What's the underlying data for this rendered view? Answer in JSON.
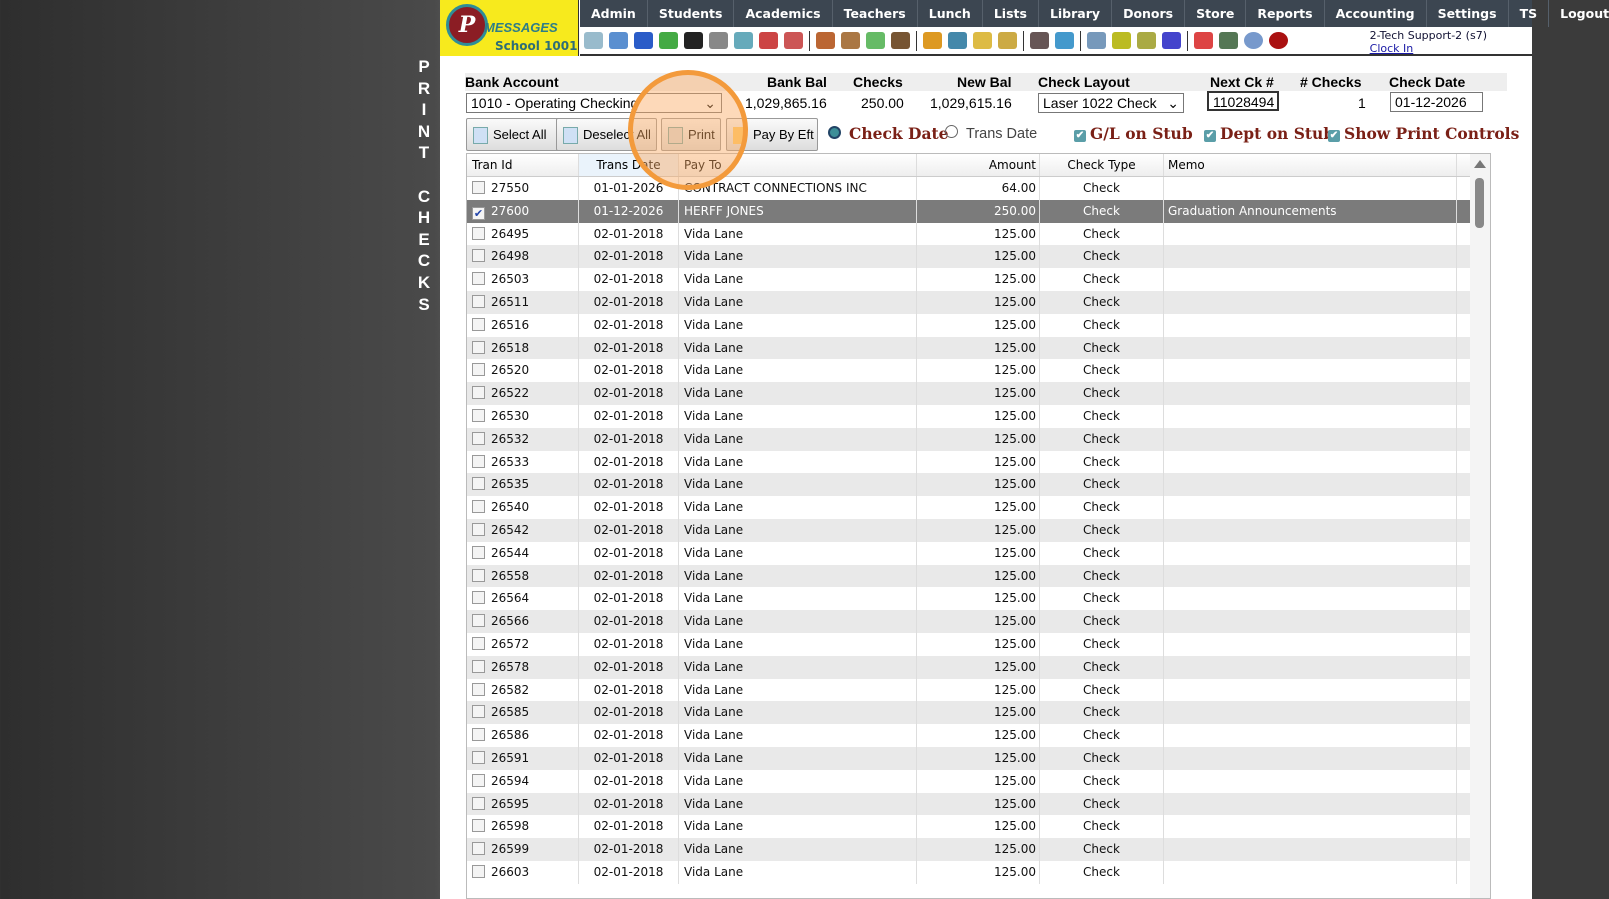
{
  "side_title": "PRINT CHECKS",
  "logo": {
    "brand": "MESSAGES",
    "school": "School 1001"
  },
  "nav": [
    "Admin",
    "Students",
    "Academics",
    "Teachers",
    "Lunch",
    "Lists",
    "Library",
    "Donors",
    "Store",
    "Reports",
    "Accounting",
    "Settings",
    "TS",
    "Logout"
  ],
  "toolbar_icons": [
    "search-icon",
    "calendar-grid-icon",
    "email-icon",
    "chat-icon",
    "phone-icon",
    "speaker-icon",
    "schedule-icon",
    "calendar-icon",
    "megaphone-icon",
    "add-user-icon",
    "user-icon",
    "money-icon",
    "group-icon",
    "burger-icon",
    "book-icon",
    "bell-icon",
    "export-icon",
    "staff-icon",
    "clock-icon",
    "table-icon",
    "card-icon",
    "printer-icon",
    "ap-icon",
    "pdf-icon",
    "cash-register-icon",
    "help-icon",
    "alert-icon"
  ],
  "user": {
    "name": "2-Tech Support-2 (s7)",
    "clock_in": "Clock In"
  },
  "form": {
    "bank_account_label": "Bank Account",
    "bank_account": "1010 - Operating Checking",
    "bank_bal_label": "Bank Bal",
    "bank_bal": "1,029,865.16",
    "checks_label": "Checks",
    "checks": "250.00",
    "new_bal_label": "New Bal",
    "new_bal": "1,029,615.16",
    "layout_label": "Check Layout",
    "layout": "Laser 1022 Check",
    "next_ck_label": "Next Ck #",
    "next_ck": "11028494",
    "num_checks_label": "# Checks",
    "num_checks": "1",
    "check_date_label": "Check Date",
    "check_date": "01-12-2026"
  },
  "buttons": {
    "select_all": "Select All",
    "deselect_all": "Deselect All",
    "print": "Print",
    "pay_eft": "Pay By Eft"
  },
  "options": {
    "check_date": "Check Date",
    "trans_date": "Trans Date",
    "gl_stub": "G/L on Stub",
    "dept_stub": "Dept on Stub",
    "show_print": "Show Print Controls"
  },
  "columns": [
    "Tran Id",
    "Trans Date",
    "Pay To",
    "Amount",
    "Check Type",
    "Memo"
  ],
  "rows": [
    {
      "id": "27550",
      "date": "01-01-2026",
      "pay": "CONTRACT CONNECTIONS INC",
      "amt": "64.00",
      "type": "Check",
      "memo": "",
      "checked": false
    },
    {
      "id": "27600",
      "date": "01-12-2026",
      "pay": "HERFF JONES",
      "amt": "250.00",
      "type": "Check",
      "memo": "Graduation Announcements",
      "checked": true
    },
    {
      "id": "26495"
    },
    {
      "id": "26498"
    },
    {
      "id": "26503"
    },
    {
      "id": "26511"
    },
    {
      "id": "26516"
    },
    {
      "id": "26518"
    },
    {
      "id": "26520"
    },
    {
      "id": "26522"
    },
    {
      "id": "26530"
    },
    {
      "id": "26532"
    },
    {
      "id": "26533"
    },
    {
      "id": "26535"
    },
    {
      "id": "26540"
    },
    {
      "id": "26542"
    },
    {
      "id": "26544"
    },
    {
      "id": "26558"
    },
    {
      "id": "26564"
    },
    {
      "id": "26566"
    },
    {
      "id": "26572"
    },
    {
      "id": "26578"
    },
    {
      "id": "26582"
    },
    {
      "id": "26585"
    },
    {
      "id": "26586"
    },
    {
      "id": "26591"
    },
    {
      "id": "26594"
    },
    {
      "id": "26595"
    },
    {
      "id": "26598"
    },
    {
      "id": "26599"
    },
    {
      "id": "26603"
    }
  ],
  "row_default": {
    "date": "02-01-2018",
    "pay": "Vida Lane",
    "amt": "125.00",
    "type": "Check",
    "memo": ""
  }
}
